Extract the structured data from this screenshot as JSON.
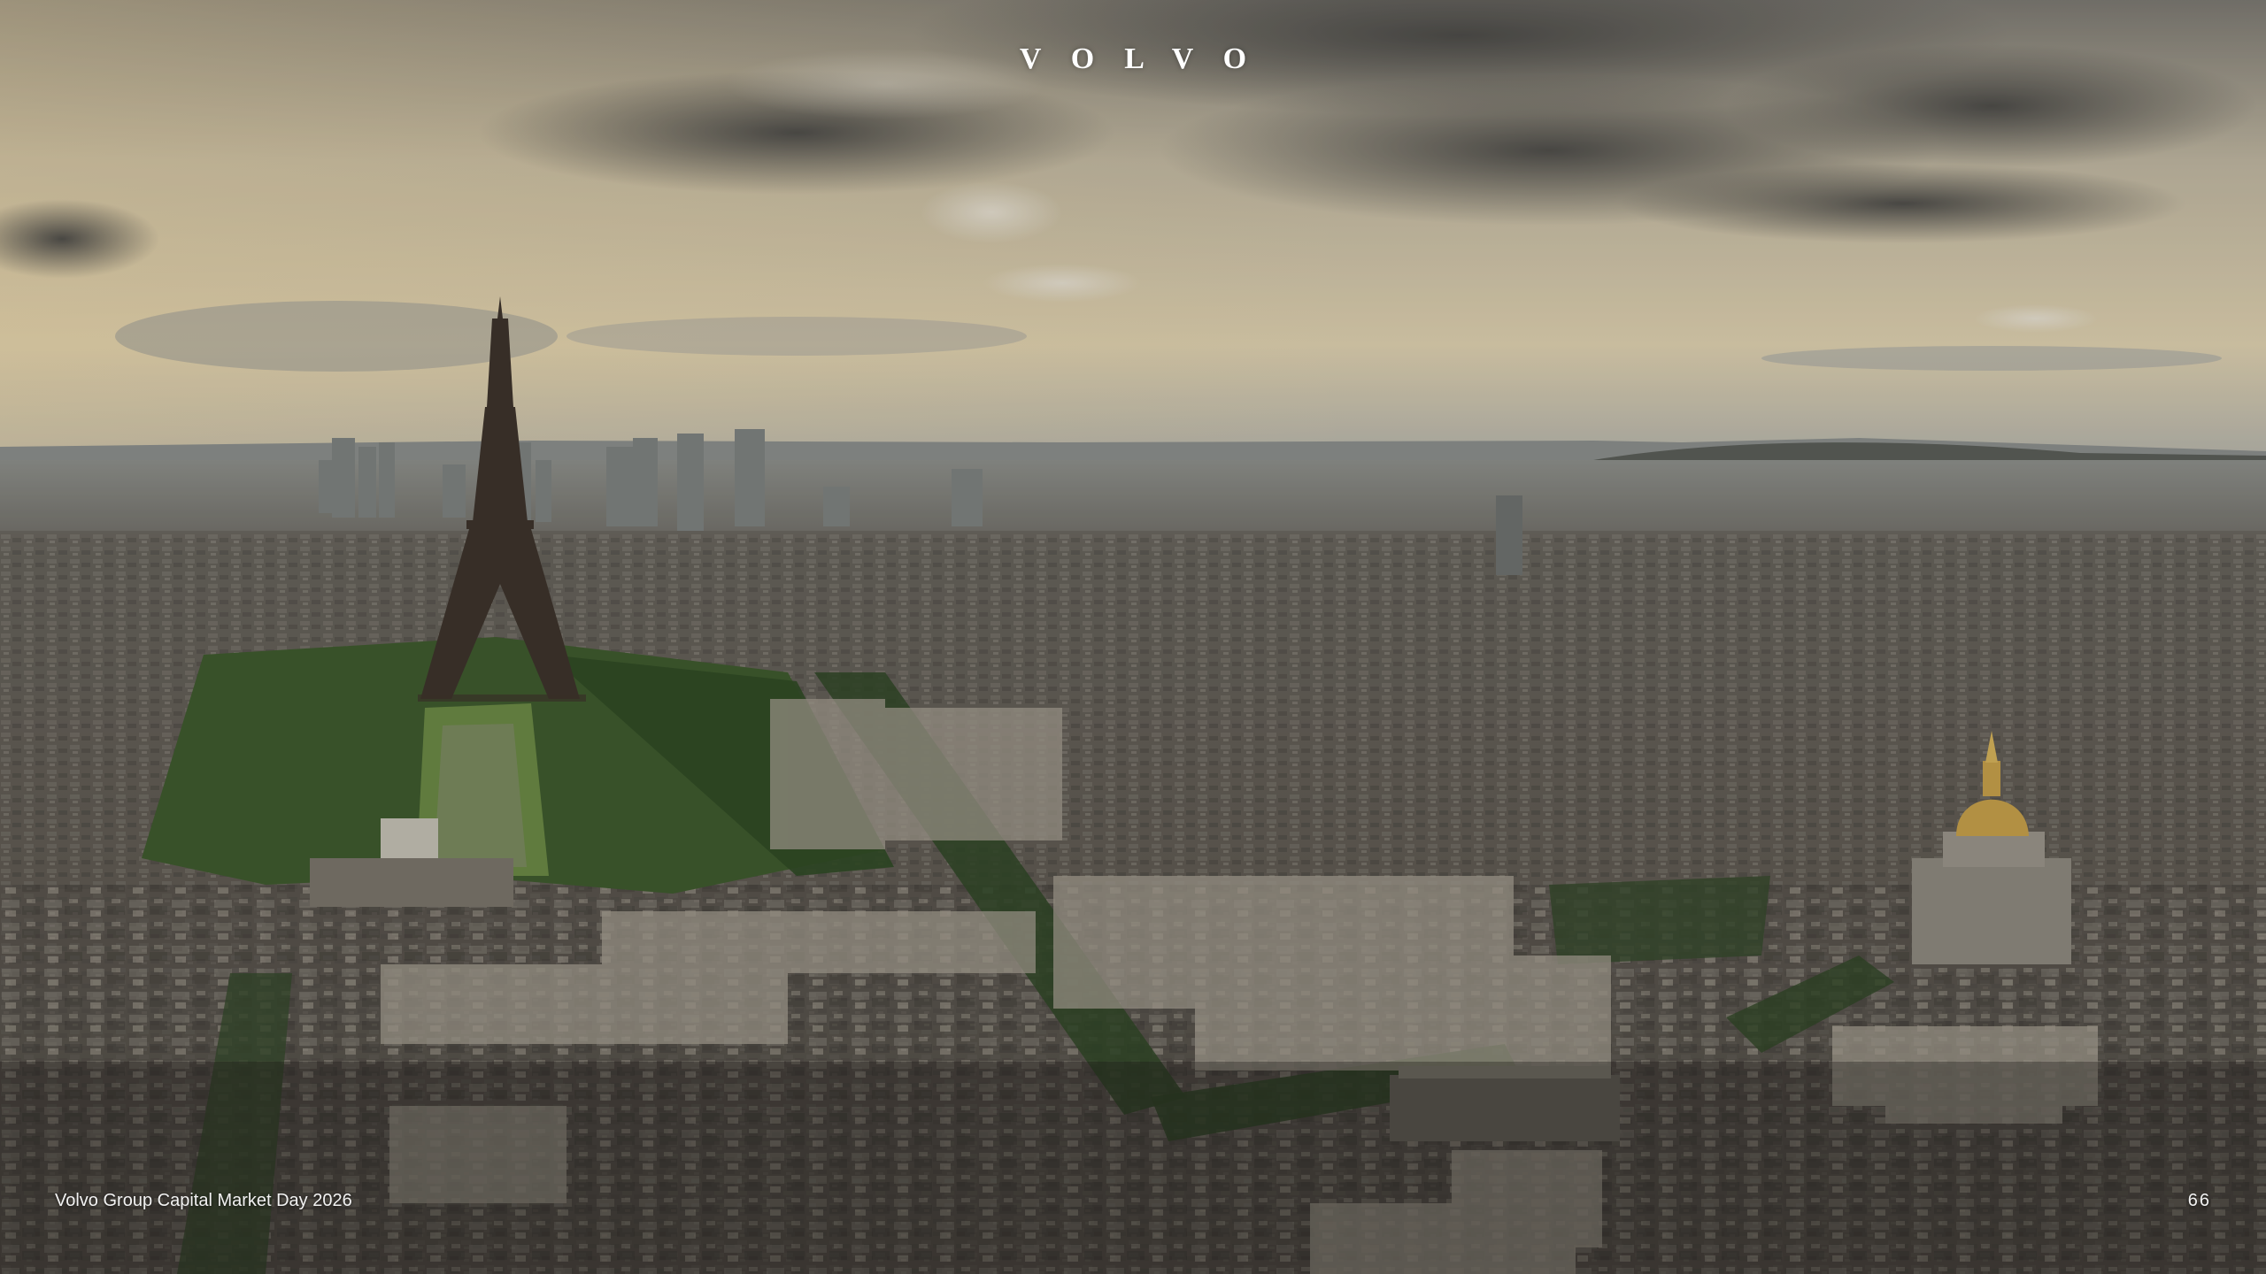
{
  "slide": {
    "logo_text": "VOLVO",
    "footer_text": "Volvo Group Capital Market Day 2026",
    "page_number": "66"
  },
  "photo": {
    "subject": "aerial-view-of-paris-with-eiffel-tower",
    "colors": {
      "sky_top": "#6f6c66",
      "sky_glow": "#e3d3ae",
      "horizon": "#a9aba6",
      "city": "#5e5a54",
      "park": "#3f5a2c",
      "dome_gold": "#c9a24a"
    }
  }
}
